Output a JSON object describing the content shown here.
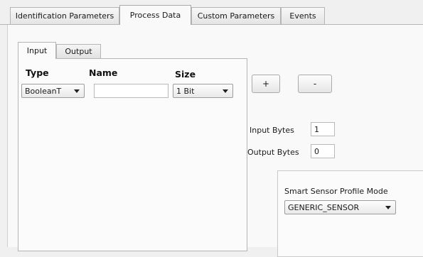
{
  "top_tabs": [
    {
      "label": "Identification Parameters",
      "active": false
    },
    {
      "label": "Process Data",
      "active": true
    },
    {
      "label": "Custom Parameters",
      "active": false
    },
    {
      "label": "Events",
      "active": false
    }
  ],
  "inner_tabs": [
    {
      "label": "Input",
      "active": true
    },
    {
      "label": "Output",
      "active": false
    }
  ],
  "table": {
    "headers": {
      "type": "Type",
      "name": "Name",
      "size": "Size"
    },
    "row": {
      "type": "BooleanT",
      "name": "",
      "size": "1 Bit"
    }
  },
  "buttons": {
    "add": "+",
    "remove": "-"
  },
  "bytes": {
    "input_label": "Input Bytes",
    "input_value": "1",
    "output_label": "Output Bytes",
    "output_value": "0"
  },
  "smart_sensor": {
    "label": "Smart Sensor Profile Mode",
    "value": "GENERIC_SENSOR"
  }
}
